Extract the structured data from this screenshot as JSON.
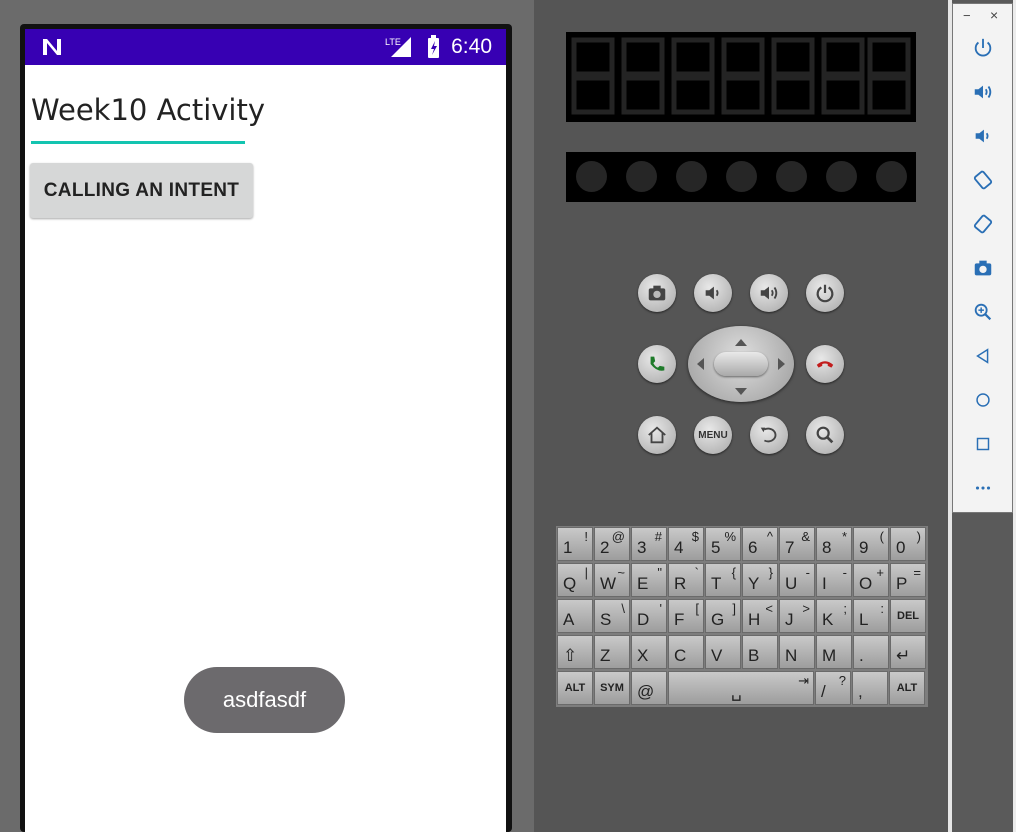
{
  "status_bar": {
    "time": "6:40",
    "network": "LTE",
    "logo": "N"
  },
  "app": {
    "title_text": "Week10 Activity",
    "button_label": "CALLING AN INTENT",
    "toast_text": "asdfasdf"
  },
  "emulator_controls": {
    "row1": [
      "camera-icon",
      "volume-down-icon",
      "volume-up-icon",
      "power-icon"
    ],
    "row2": [
      "call-icon",
      "dpad",
      "end-call-icon"
    ],
    "row3": [
      "home-icon",
      "menu-button",
      "back-icon",
      "search-icon"
    ],
    "menu_label": "MENU"
  },
  "keyboard": {
    "row1": [
      [
        "1",
        "!"
      ],
      [
        "2",
        "@"
      ],
      [
        "3",
        "#"
      ],
      [
        "4",
        "$"
      ],
      [
        "5",
        "%"
      ],
      [
        "6",
        "^"
      ],
      [
        "7",
        "&"
      ],
      [
        "8",
        "*"
      ],
      [
        "9",
        "("
      ],
      [
        "0",
        ")"
      ]
    ],
    "row2": [
      [
        "Q",
        "|"
      ],
      [
        "W",
        "~"
      ],
      [
        "E",
        "\""
      ],
      [
        "R",
        "`"
      ],
      [
        "T",
        "{"
      ],
      [
        "Y",
        "}"
      ],
      [
        "U",
        "-"
      ],
      [
        "I",
        "-"
      ],
      [
        "O",
        "+"
      ],
      [
        "P",
        "="
      ]
    ],
    "row3": [
      [
        "A",
        ""
      ],
      [
        "S",
        "\\"
      ],
      [
        "D",
        "'"
      ],
      [
        "F",
        "["
      ],
      [
        "G",
        "]"
      ],
      [
        "H",
        "<"
      ],
      [
        "J",
        ">"
      ],
      [
        "K",
        ";"
      ],
      [
        "L",
        ":"
      ],
      [
        "DEL",
        ""
      ]
    ],
    "row4": [
      [
        "⇧",
        ""
      ],
      [
        "Z",
        ""
      ],
      [
        "X",
        ""
      ],
      [
        "C",
        ""
      ],
      [
        "V",
        ""
      ],
      [
        "B",
        ""
      ],
      [
        "N",
        ""
      ],
      [
        "M",
        ""
      ],
      [
        ".",
        ""
      ],
      [
        "↵",
        ""
      ]
    ],
    "row5": [
      [
        "ALT",
        ""
      ],
      [
        "SYM",
        ""
      ],
      [
        "@",
        ""
      ],
      [
        "␣",
        "⇥"
      ],
      [
        "/",
        "?"
      ],
      [
        ",",
        ""
      ],
      [
        "ALT",
        ""
      ]
    ]
  },
  "toolbar": {
    "minimize": "−",
    "close": "×",
    "icons": [
      "power-icon",
      "volume-up-icon",
      "volume-down-icon",
      "rotate-left-icon",
      "rotate-right-icon",
      "screenshot-icon",
      "zoom-icon",
      "back-icon",
      "home-icon",
      "overview-icon",
      "more-icon"
    ]
  }
}
